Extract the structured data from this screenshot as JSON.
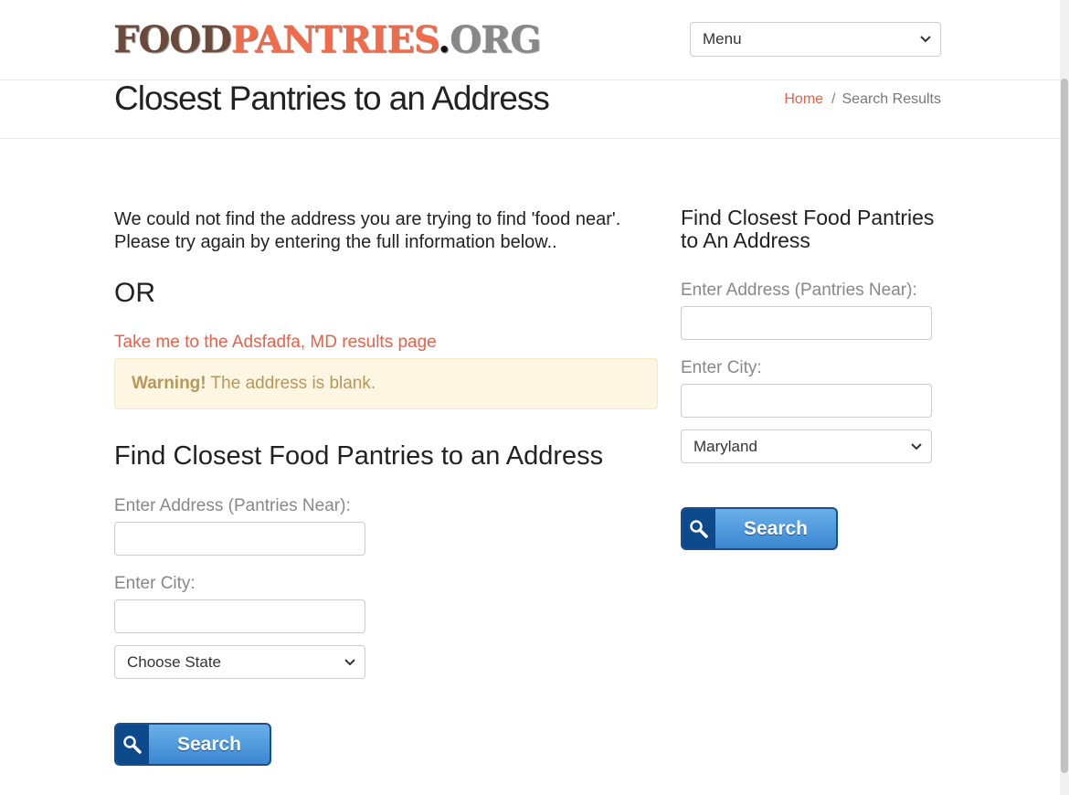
{
  "header": {
    "logo": {
      "part1": "FOOD",
      "part2": "PANTRIES",
      "part3": ".",
      "part4": "ORG"
    },
    "menu_select": "Menu"
  },
  "titlebar": {
    "title": "Closest Pantries to an Address",
    "breadcrumb": {
      "home": "Home",
      "separator": "/",
      "current": "Search Results"
    }
  },
  "main": {
    "message_line1": "We could not find the address you are trying to find 'food near'.",
    "message_line2": "Please try again by entering the full information below..",
    "or_text": "OR",
    "results_link": "Take me to the Adsfadfa, MD results page",
    "alert": {
      "strong": "Warning!",
      "text": " The address is blank."
    },
    "form": {
      "heading": "Find Closest Food Pantries to an Address",
      "address_label": "Enter Address (Pantries Near):",
      "address_value": "",
      "city_label": "Enter City:",
      "city_value": "",
      "state_value": "Choose State",
      "search_label": "Search"
    }
  },
  "sidebar": {
    "heading": "Find Closest Food Pantries to An Address",
    "address_label": "Enter Address (Pantries Near):",
    "address_value": "",
    "city_label": "Enter City:",
    "city_value": "",
    "state_value": "Maryland",
    "search_label": "Search"
  },
  "colors": {
    "accent": "#e8614a",
    "alert_bg": "#fcf6e3",
    "alert_text": "#b9975a",
    "button_blue": "#3a86d0"
  }
}
